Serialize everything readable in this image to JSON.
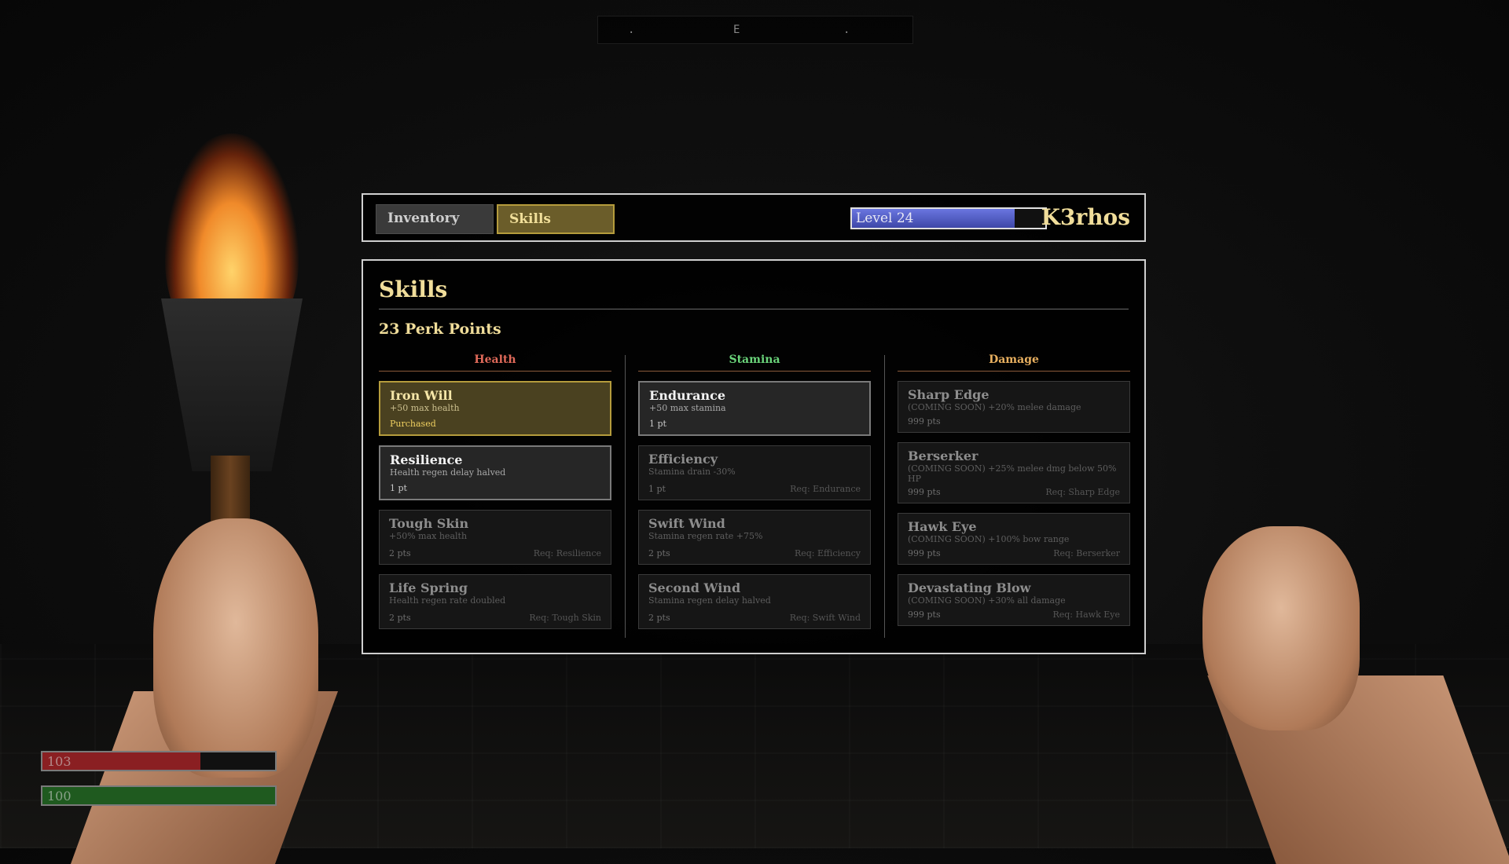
{
  "compass": {
    "heading": "E",
    "left_tick": ".",
    "right_tick": "."
  },
  "tabs": [
    {
      "label": "Inventory",
      "active": false
    },
    {
      "label": "Skills",
      "active": true
    }
  ],
  "player": {
    "level_label": "Level 24",
    "level_progress": 0.84,
    "name": "K3rhos"
  },
  "panel": {
    "title": "Skills",
    "perk_points": "23 Perk Points"
  },
  "columns": [
    {
      "name": "Health",
      "color": "#e06a5a",
      "skills": [
        {
          "name": "Iron Will",
          "desc": "+50 max health",
          "cost": "Purchased",
          "req": "",
          "state": "purchased"
        },
        {
          "name": "Resilience",
          "desc": "Health regen delay halved",
          "cost": "1 pt",
          "req": "",
          "state": "available"
        },
        {
          "name": "Tough Skin",
          "desc": "+50% max health",
          "cost": "2 pts",
          "req": "Req: Resilience",
          "state": "locked"
        },
        {
          "name": "Life Spring",
          "desc": "Health regen rate doubled",
          "cost": "2 pts",
          "req": "Req: Tough Skin",
          "state": "locked"
        }
      ]
    },
    {
      "name": "Stamina",
      "color": "#6ad47a",
      "skills": [
        {
          "name": "Endurance",
          "desc": "+50 max stamina",
          "cost": "1 pt",
          "req": "",
          "state": "available"
        },
        {
          "name": "Efficiency",
          "desc": "Stamina drain -30%",
          "cost": "1 pt",
          "req": "Req: Endurance",
          "state": "locked"
        },
        {
          "name": "Swift Wind",
          "desc": "Stamina regen rate +75%",
          "cost": "2 pts",
          "req": "Req: Efficiency",
          "state": "locked"
        },
        {
          "name": "Second Wind",
          "desc": "Stamina regen delay halved",
          "cost": "2 pts",
          "req": "Req: Swift Wind",
          "state": "locked"
        }
      ]
    },
    {
      "name": "Damage",
      "color": "#e8b060",
      "skills": [
        {
          "name": "Sharp Edge",
          "desc": "(COMING SOON) +20% melee damage",
          "cost": "999 pts",
          "req": "",
          "state": "locked"
        },
        {
          "name": "Berserker",
          "desc": "(COMING SOON) +25% melee dmg below 50% HP",
          "cost": "999 pts",
          "req": "Req: Sharp Edge",
          "state": "locked"
        },
        {
          "name": "Hawk Eye",
          "desc": "(COMING SOON) +100% bow range",
          "cost": "999 pts",
          "req": "Req: Berserker",
          "state": "locked"
        },
        {
          "name": "Devastating Blow",
          "desc": "(COMING SOON) +30% all damage",
          "cost": "999 pts",
          "req": "Req: Hawk Eye",
          "state": "locked"
        }
      ]
    }
  ],
  "hud": {
    "health": {
      "value": "103",
      "fraction": 0.68,
      "color": "#8a1f22"
    },
    "stamina": {
      "value": "100",
      "fraction": 1.0,
      "color": "#1f5a1f"
    }
  }
}
